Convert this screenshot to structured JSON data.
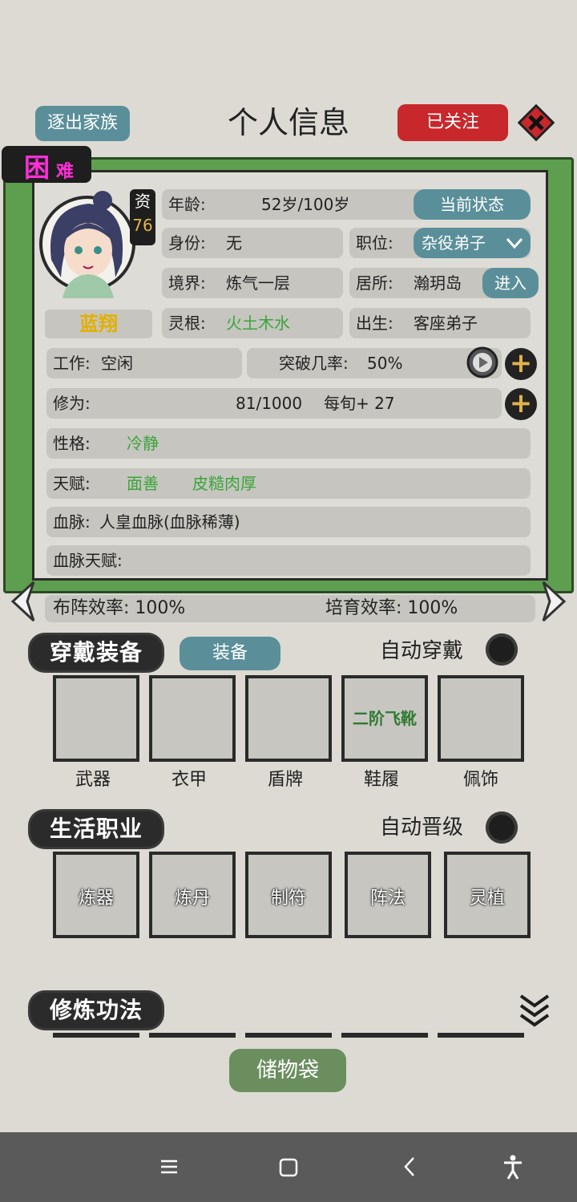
{
  "header": {
    "expel_button": "逐出家族",
    "title": "个人信息",
    "follow_button": "已关注"
  },
  "card": {
    "status_badge": {
      "main": "困",
      "sub": "难"
    },
    "aptitude": {
      "label": "资",
      "value": "76"
    },
    "name": "蓝翔",
    "age": {
      "label": "年龄:",
      "value": "52岁/100岁",
      "button": "当前状态"
    },
    "identity": {
      "label": "身份:",
      "value": "无"
    },
    "position": {
      "label": "职位:",
      "value": "杂役弟子"
    },
    "realm": {
      "label": "境界:",
      "value": "炼气一层"
    },
    "residence": {
      "label": "居所:",
      "value": "瀚玥岛",
      "button": "进入"
    },
    "root": {
      "label": "灵根:",
      "value": "火土木水"
    },
    "birth": {
      "label": "出生:",
      "value": "客座弟子"
    },
    "work": {
      "label": "工作:",
      "value": "空闲"
    },
    "breakthrough": {
      "label": "突破几率:",
      "value": "50%"
    },
    "cultivation": {
      "label": "修为:",
      "value": "81/1000",
      "per": "每旬+ 27"
    },
    "personality": {
      "label": "性格:",
      "value": "冷静"
    },
    "talent": {
      "label": "天赋:",
      "values": [
        "面善",
        "皮糙肉厚"
      ]
    },
    "bloodline": {
      "label": "血脉:",
      "value": "人皇血脉(血脉稀薄)"
    },
    "bloodline_talent": {
      "label": "血脉天赋:",
      "value": ""
    }
  },
  "efficiency": {
    "formation": "布阵效率: 100%",
    "breeding": "培育效率: 100%"
  },
  "equipment": {
    "title": "穿戴装备",
    "equip_button": "装备",
    "auto_label": "自动穿戴",
    "slots": [
      {
        "label": "武器",
        "item": ""
      },
      {
        "label": "衣甲",
        "item": ""
      },
      {
        "label": "盾牌",
        "item": ""
      },
      {
        "label": "鞋履",
        "item": "二阶飞靴"
      },
      {
        "label": "佩饰",
        "item": ""
      }
    ]
  },
  "life": {
    "title": "生活职业",
    "auto_label": "自动晋级",
    "slots": [
      "炼器",
      "炼丹",
      "制符",
      "阵法",
      "灵植"
    ]
  },
  "techniques": {
    "title": "修炼功法"
  },
  "storage_button": "储物袋",
  "colors": {
    "frame_green": "#5d9f4f",
    "teal": "#5a8f9a",
    "red": "#c8282b",
    "talent_green": "#3aa53a",
    "magenta": "#ff2fd8",
    "gold": "#e3b24b"
  }
}
